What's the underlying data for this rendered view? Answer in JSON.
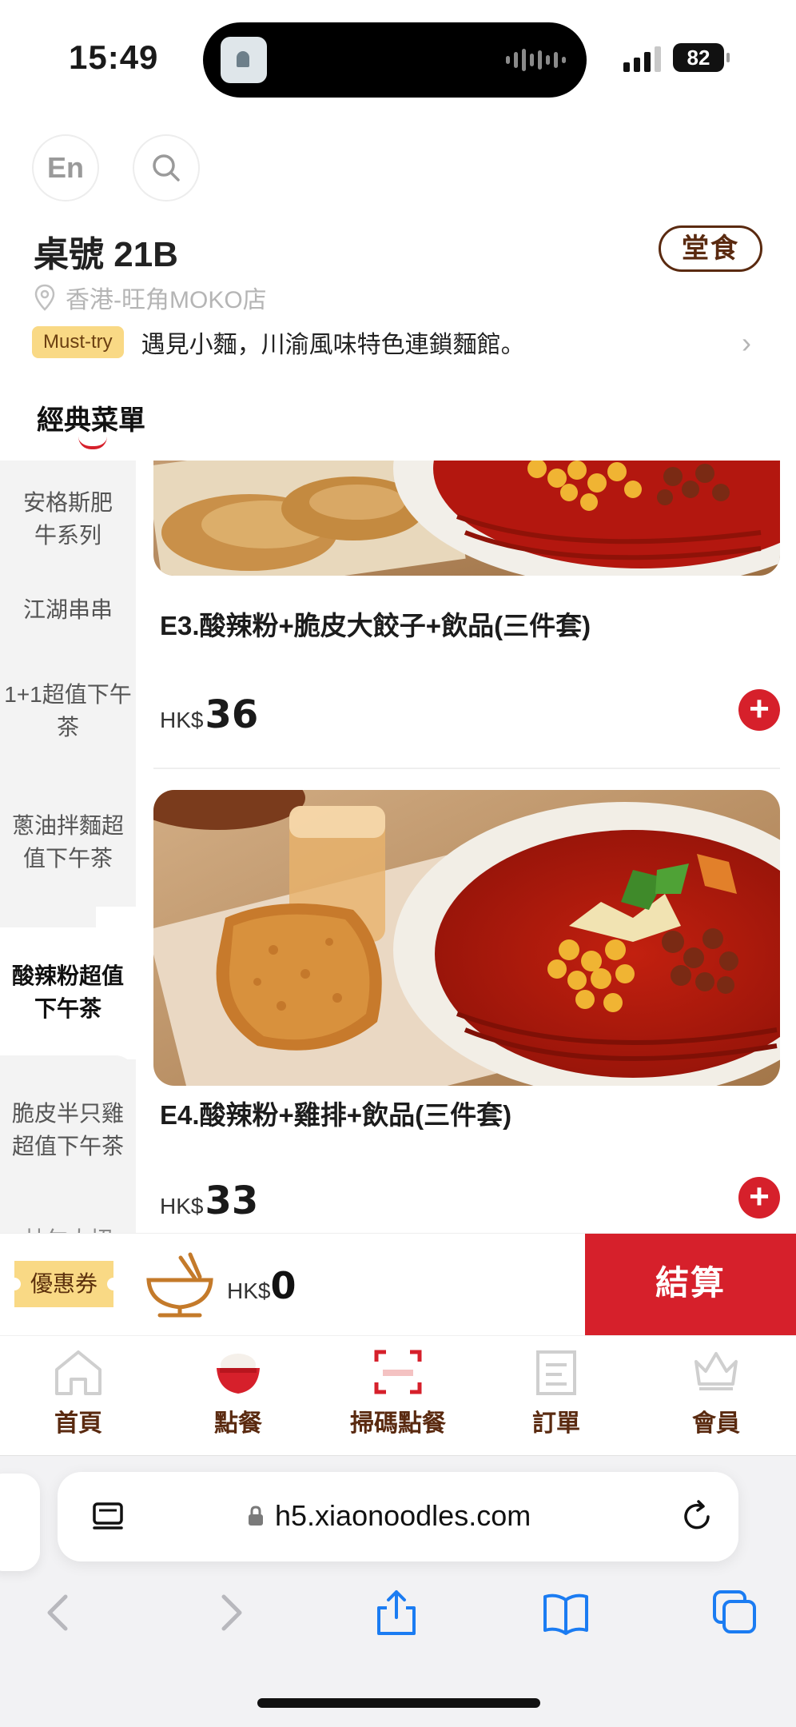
{
  "status_bar": {
    "time": "15:49",
    "battery": "82"
  },
  "header": {
    "lang_button": "En",
    "search_icon": "search-icon",
    "table_title": "桌號 21B",
    "dine_in_badge": "堂食",
    "location": "香港-旺角MOKO店",
    "must_try_badge": "Must-try",
    "tagline": "遇見小麵，川渝風味特色連鎖麵館。",
    "menu_tab": "經典菜單"
  },
  "sidebar": {
    "items": [
      {
        "label": "安格斯肥牛系列"
      },
      {
        "label": "江湖串串"
      },
      {
        "label": "1+1超值下午茶"
      },
      {
        "label": "蔥油拌麵超值下午茶"
      },
      {
        "label": "酸辣粉超值下午茶",
        "active": true
      },
      {
        "label": "脆皮半只雞超值下午茶"
      },
      {
        "label": "林尔大招"
      }
    ]
  },
  "menu_items": [
    {
      "title": "E3.酸辣粉+脆皮大餃子+飲品(三件套)",
      "currency": "HK$",
      "price": "36"
    },
    {
      "title": "E4.酸辣粉+雞排+飲品(三件套)",
      "currency": "HK$",
      "price": "33"
    }
  ],
  "cart": {
    "coupon": "優惠券",
    "currency": "HK$",
    "total": "0",
    "checkout": "結算"
  },
  "bottom_nav": [
    {
      "label": "首頁",
      "icon": "home-icon"
    },
    {
      "label": "點餐",
      "icon": "rice-bowl-icon"
    },
    {
      "label": "掃碼點餐",
      "icon": "scan-icon"
    },
    {
      "label": "訂單",
      "icon": "receipt-icon"
    },
    {
      "label": "會員",
      "icon": "crown-icon"
    }
  ],
  "browser": {
    "url": "h5.xiaonoodles.com"
  },
  "colors": {
    "brand_red": "#d6202b",
    "brand_brown": "#5a2a10",
    "coupon_yellow": "#f9d985"
  }
}
